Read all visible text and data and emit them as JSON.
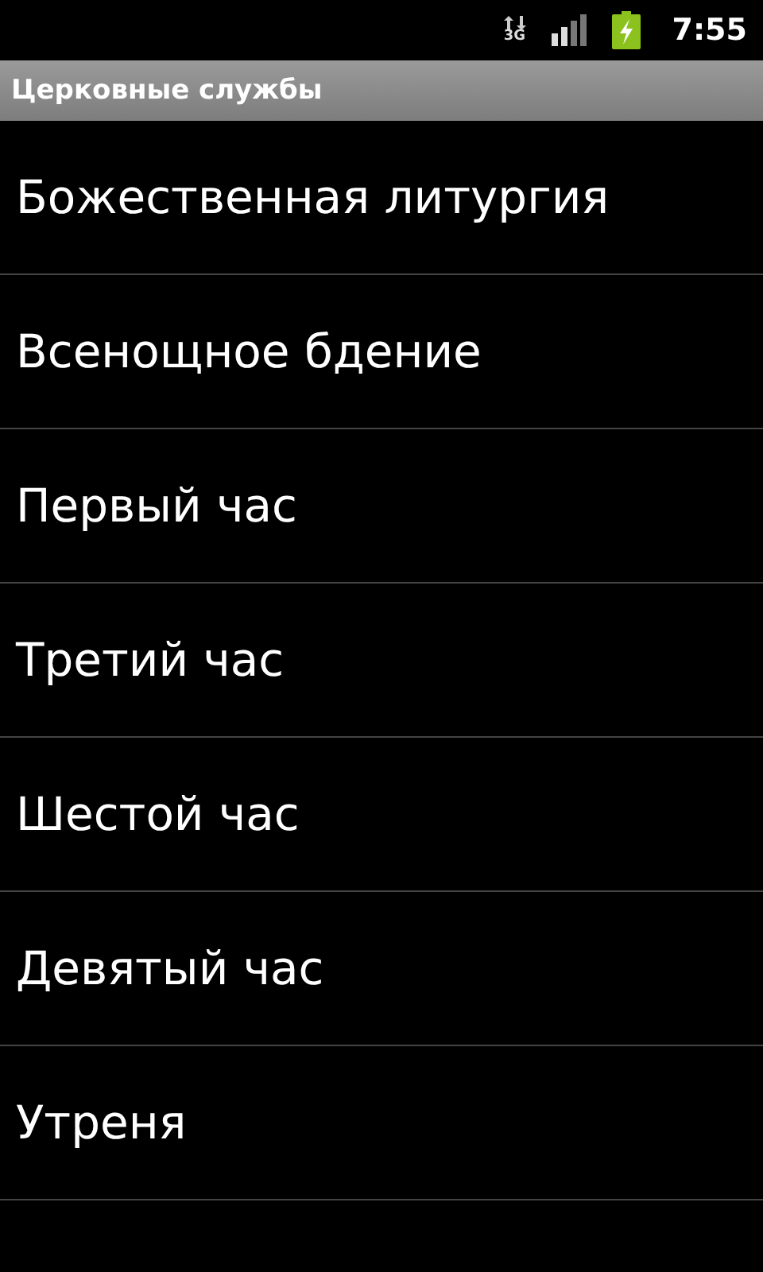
{
  "status_bar": {
    "network": "3G",
    "time": "7:55"
  },
  "title": "Церковные службы",
  "items": [
    {
      "label": "Божественная литургия"
    },
    {
      "label": "Всенощное бдение"
    },
    {
      "label": "Первый час"
    },
    {
      "label": "Третий час"
    },
    {
      "label": "Шестой час"
    },
    {
      "label": "Девятый час"
    },
    {
      "label": "Утреня"
    }
  ]
}
